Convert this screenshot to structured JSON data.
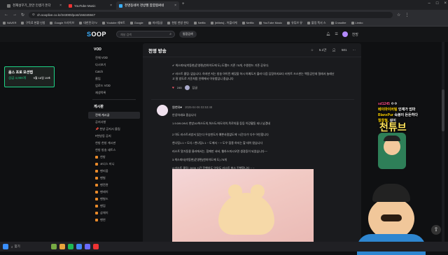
{
  "browser": {
    "tabs": [
      {
        "label": "천재설꾸기_천안 인생기 돈다"
      },
      {
        "label": "YouTube Music"
      },
      {
        "label": "천명동네어 천방헬 깜깜찜싸네"
      }
    ],
    "url": "ch.sooplive.co.kr/243000/post/156345947",
    "bookmarks": [
      "NAVER",
      "구독료 현황 신청",
      "Google 드라이브",
      "대한민국TV",
      "Youtube 레포트",
      "Google",
      "미러링글",
      "천방 천방 한다",
      "Netflix",
      "[trilllets] - 어플리케",
      "Netflix",
      "YouTube Music",
      "유튜브 뮤",
      "블링 쪽서 스",
      "Crossfire",
      "Limbo"
    ]
  },
  "header": {
    "logo_prefix": "S",
    "logo_rest": "OOP",
    "search_placeholder": "채널 검색",
    "search_button": "통합검색",
    "user_label": "천방"
  },
  "sidebar": {
    "section_vod": "VOD",
    "vod_items": [
      "전체 VOD",
      "다시보기",
      "Catch",
      "클립",
      "업로드 VOD",
      "재생목록"
    ],
    "section_board": "게시판",
    "board_items": [
      "전체 게시글",
      "공지사항",
      "📌 천방 공지시 올림",
      "#천방동 공지"
    ],
    "board_items2": [
      "천방 천방 게시판",
      "천방 방송 세트스"
    ],
    "board_sub": [
      "천방",
      "코너스 미니",
      "팬리움",
      "팬빌",
      "팬전관",
      "팬레이",
      "팬빌드",
      "팬덤",
      "삼체이",
      "팬연"
    ]
  },
  "ad": {
    "title": "옴스 프로 모션탭",
    "price": "상금 4,000개",
    "dates": "9월 16일 19초"
  },
  "main": {
    "title": "천영 방송",
    "stat1": "5.1만",
    "stat2": "501",
    "post1_line1": "✔ 섹스피터(박동현)운영편(천하이도에 도) 도팽드 기존 75개, 수원한드 기존 공유다.",
    "post1_line2": "✔ 러스트 콜링: 없습니다. 하지만 저는 방송 아이린 재밌을 하시 아예도가 블러 다음 답장하지요다 러쉬트 즈스한는 백동공인데 절래서 놀래난",
    "post1_line3": "고 잘 방도로 기준처럼 인해에서 이유범입니 중습니다",
    "likes": "245",
    "reply_label": "답글",
    "post2_author": "원천유♥",
    "post2_date": "2025-04-06 03:53:48",
    "post2_lines": [
      "안녕하세요 중습니다",
      "1.9.0/9.0/9시 천방10/허스도의,허스도/하도의이,목로의을 등등 이강활동 되나 남겠네",
      "2.이도 러스트서방서 있는다 우승천도가 예쁜사람없도에 '시간다가' 다수 어인합니다",
      "천나팅1.1 + 도다 / 천나팅1.1 ~ 도에서 ~ + 도우 접종 하지는 할 데이 왔습니다",
      "러스트 알가동용 울라에서는, 함께만 서버, 웹하스피시오면 생경등이 되었습니다~~",
      "3.섹스피터(박동현)운영편(천하이도에 도) 75개",
      "4.러스트 콜링: 2835 시간 진행하도 이유도 러스트 화스 진행합니다 ~ ~"
    ]
  },
  "overlay": {
    "chat1_name": "sd1245",
    "chat1_msg": "ㅇㅇ",
    "chat2_name": "베이마이버팀",
    "chat2_msg": "인재가 엄마",
    "chat3_name": "BlanxPur",
    "chat3_msg": "숙봉이 든든하다",
    "chat4_name": "철찰월,",
    "chat4_msg": "설이",
    "big_text": "천튜브"
  },
  "taskbar": {
    "search_label": "찾기"
  }
}
